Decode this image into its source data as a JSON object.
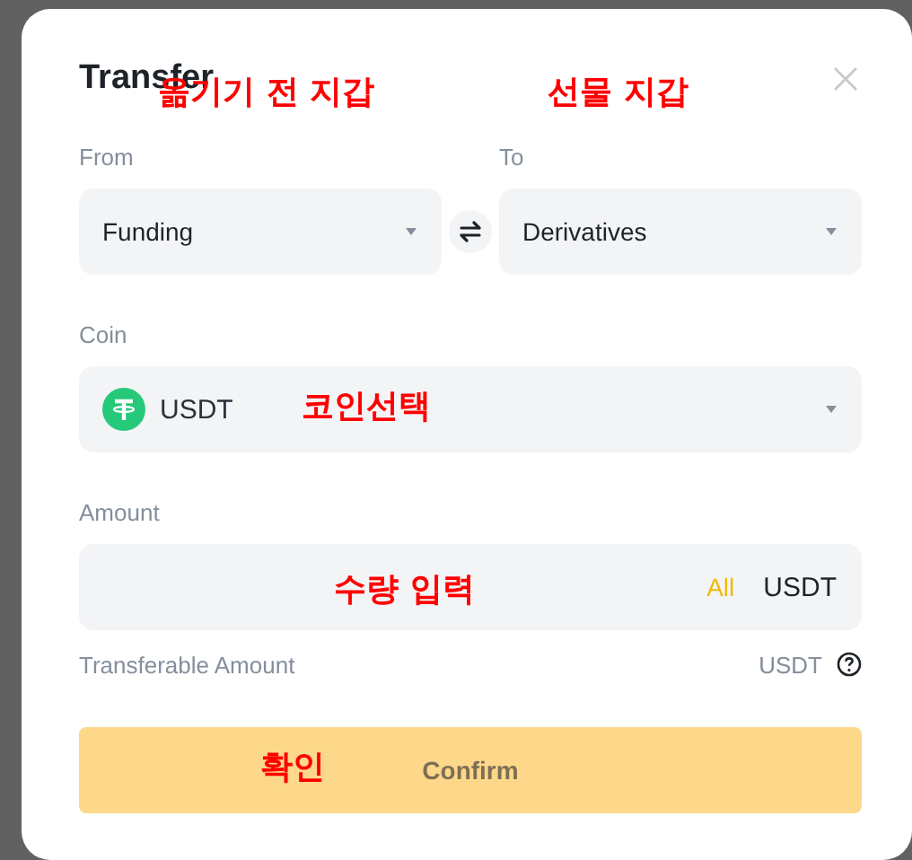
{
  "window": {
    "title": "Transfer"
  },
  "from": {
    "label": "From",
    "value": "Funding",
    "annotation": "옮기기 전 지갑"
  },
  "to": {
    "label": "To",
    "value": "Derivatives",
    "annotation": "선물 지갑"
  },
  "coin": {
    "label": "Coin",
    "value": "USDT",
    "annotation": "코인선택"
  },
  "amount": {
    "label": "Amount",
    "all_label": "All",
    "unit": "USDT",
    "annotation": "수량 입력"
  },
  "transferable": {
    "label": "Transferable Amount",
    "unit": "USDT"
  },
  "confirm_button": {
    "label": "Confirm",
    "disabled": true,
    "annotation": "확인"
  }
}
